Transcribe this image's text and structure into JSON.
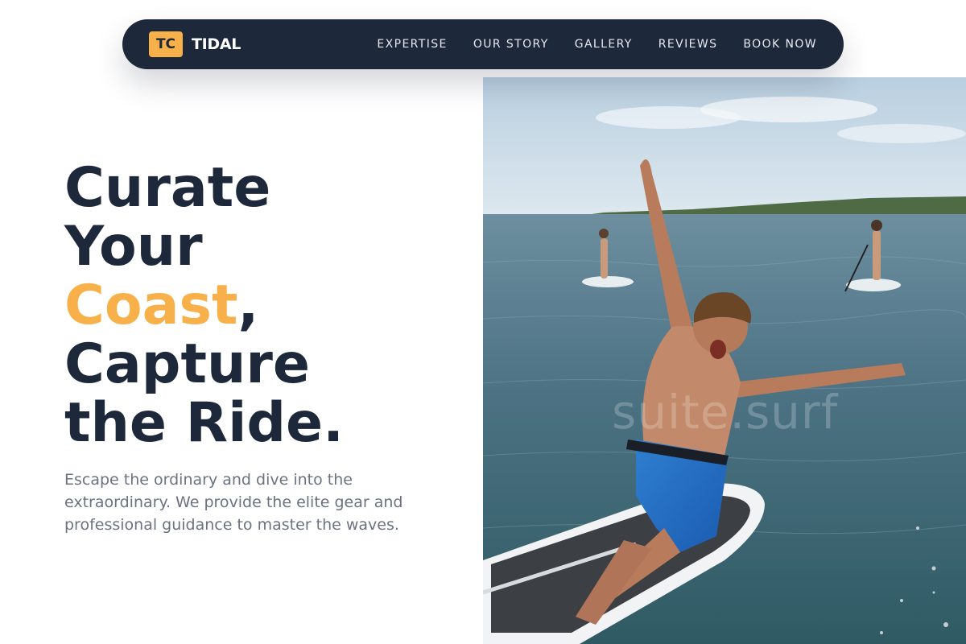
{
  "brand": {
    "badge": "TC",
    "name": "TIDAL"
  },
  "nav": {
    "items": [
      {
        "label": "EXPERTISE"
      },
      {
        "label": "OUR STORY"
      },
      {
        "label": "GALLERY"
      },
      {
        "label": "REVIEWS"
      },
      {
        "label": "BOOK NOW"
      }
    ]
  },
  "hero": {
    "title_line1": "Curate",
    "title_line2": "Your",
    "title_accent": "Coast",
    "title_comma": ",",
    "title_line4": "Capture",
    "title_line5": "the Ride.",
    "description": "Escape the ordinary and dive into the extraordinary. We provide the elite gear and professional guidance to master the waves.",
    "photo_watermark": "suite.surf"
  },
  "colors": {
    "navy": "#1e283b",
    "accent": "#f8b04a",
    "body_text": "#6b7280",
    "background": "#ffffff"
  }
}
